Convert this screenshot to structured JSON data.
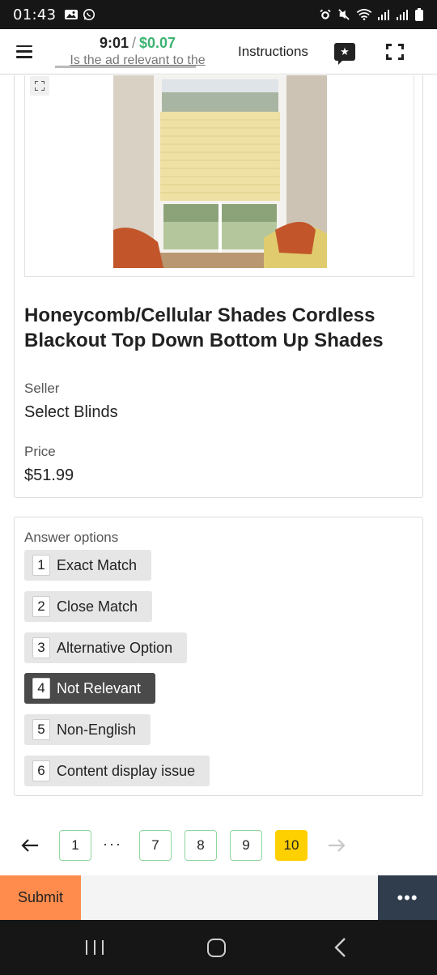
{
  "status_bar": {
    "time": "01:43",
    "left_icons": [
      "gallery-icon",
      "whatsapp-icon"
    ],
    "right_icons": [
      "alarm-icon",
      "mute-icon",
      "wifi-icon",
      "signal-icon",
      "signal-icon",
      "battery-icon"
    ]
  },
  "header": {
    "timer": "9:01",
    "separator": "/",
    "reward": "$0.07",
    "task_question": "Is the ad relevant to the",
    "instructions_label": "Instructions",
    "star_icon": "star-message-icon",
    "fullscreen_icon": "fullscreen-icon"
  },
  "product": {
    "title": "Honeycomb/Cellular Shades Cordless Blackout Top Down Bottom Up Shades",
    "seller_label": "Seller",
    "seller_value": "Select Blinds",
    "price_label": "Price",
    "price_value": "$51.99"
  },
  "answers": {
    "title": "Answer options",
    "options": [
      {
        "key": "1",
        "label": "Exact Match",
        "selected": false
      },
      {
        "key": "2",
        "label": "Close Match",
        "selected": false
      },
      {
        "key": "3",
        "label": "Alternative Option",
        "selected": false
      },
      {
        "key": "4",
        "label": "Not Relevant",
        "selected": true
      },
      {
        "key": "5",
        "label": "Non-English",
        "selected": false
      },
      {
        "key": "6",
        "label": "Content display issue",
        "selected": false
      }
    ]
  },
  "pagination": {
    "prev_icon": "arrow-left-icon",
    "pages": [
      "1",
      "7",
      "8",
      "9",
      "10"
    ],
    "ellipsis": "···",
    "current_page": "10",
    "next_icon": "arrow-right-icon"
  },
  "actions": {
    "submit_label": "Submit",
    "more_label": "•••"
  },
  "colors": {
    "reward_green": "#3cb371",
    "selected_option": "#4a4a4a",
    "current_page": "#ffd000",
    "page_border": "#8fd6a0",
    "submit": "#ff8c4d",
    "more_button": "#2f3d4c"
  }
}
